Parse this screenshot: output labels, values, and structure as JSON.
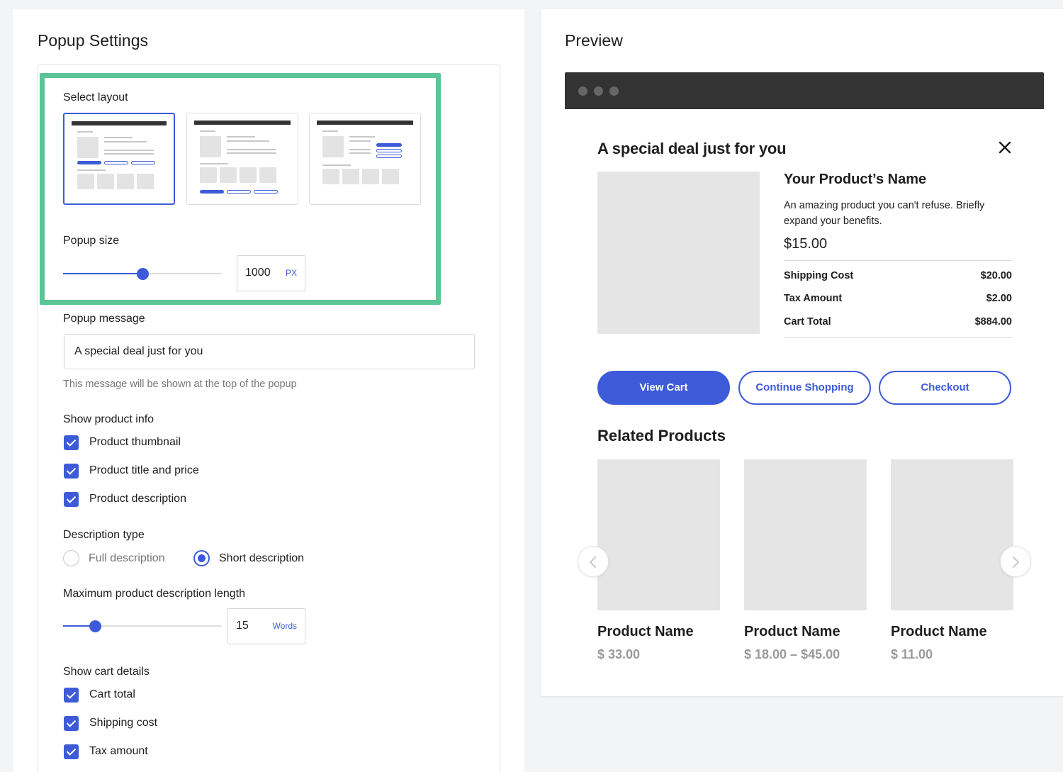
{
  "settings": {
    "title": "Popup Settings",
    "select_layout_label": "Select layout",
    "popup_size_label": "Popup size",
    "popup_size_value": "1000",
    "popup_size_unit": "PX",
    "popup_size_fraction": 0.5,
    "popup_message_label": "Popup message",
    "popup_message_value": "A special deal just for you",
    "popup_message_help": "This message will be shown at the top of the popup",
    "show_product_info_label": "Show product info",
    "product_info_options": [
      {
        "label": "Product thumbnail",
        "checked": true
      },
      {
        "label": "Product title and price",
        "checked": true
      },
      {
        "label": "Product description",
        "checked": true
      }
    ],
    "description_type_label": "Description type",
    "description_type_options": [
      {
        "label": "Full description",
        "selected": false
      },
      {
        "label": "Short description",
        "selected": true
      }
    ],
    "max_desc_length_label": "Maximum product description length",
    "max_desc_length_value": "15",
    "max_desc_length_unit": "Words",
    "max_desc_length_fraction": 0.2,
    "show_cart_details_label": "Show cart details",
    "cart_details_options": [
      {
        "label": "Cart total",
        "checked": true
      },
      {
        "label": "Shipping cost",
        "checked": true
      },
      {
        "label": "Tax amount",
        "checked": true
      }
    ]
  },
  "preview": {
    "title": "Preview",
    "popup_heading": "A special deal just for you",
    "product_name": "Your Product’s Name",
    "product_description": "An amazing product you can't refuse. Briefly expand your benefits.",
    "product_price": "$15.00",
    "costs": [
      {
        "label": "Shipping Cost",
        "value": "$20.00"
      },
      {
        "label": "Tax Amount",
        "value": "$2.00"
      },
      {
        "label": "Cart Total",
        "value": "$884.00"
      }
    ],
    "buttons": {
      "view_cart": "View Cart",
      "continue_shopping": "Continue Shopping",
      "checkout": "Checkout"
    },
    "related_title": "Related Products",
    "related_products": [
      {
        "name": "Product Name",
        "price": "$ 33.00"
      },
      {
        "name": "Product Name",
        "price": "$ 18.00 – $45.00"
      },
      {
        "name": "Product Name",
        "price": "$ 11.00"
      }
    ]
  },
  "colors": {
    "accent": "#3d5bd9",
    "highlight": "#5cc596",
    "browser_bar": "#333333",
    "placeholder": "#e5e5e5"
  }
}
